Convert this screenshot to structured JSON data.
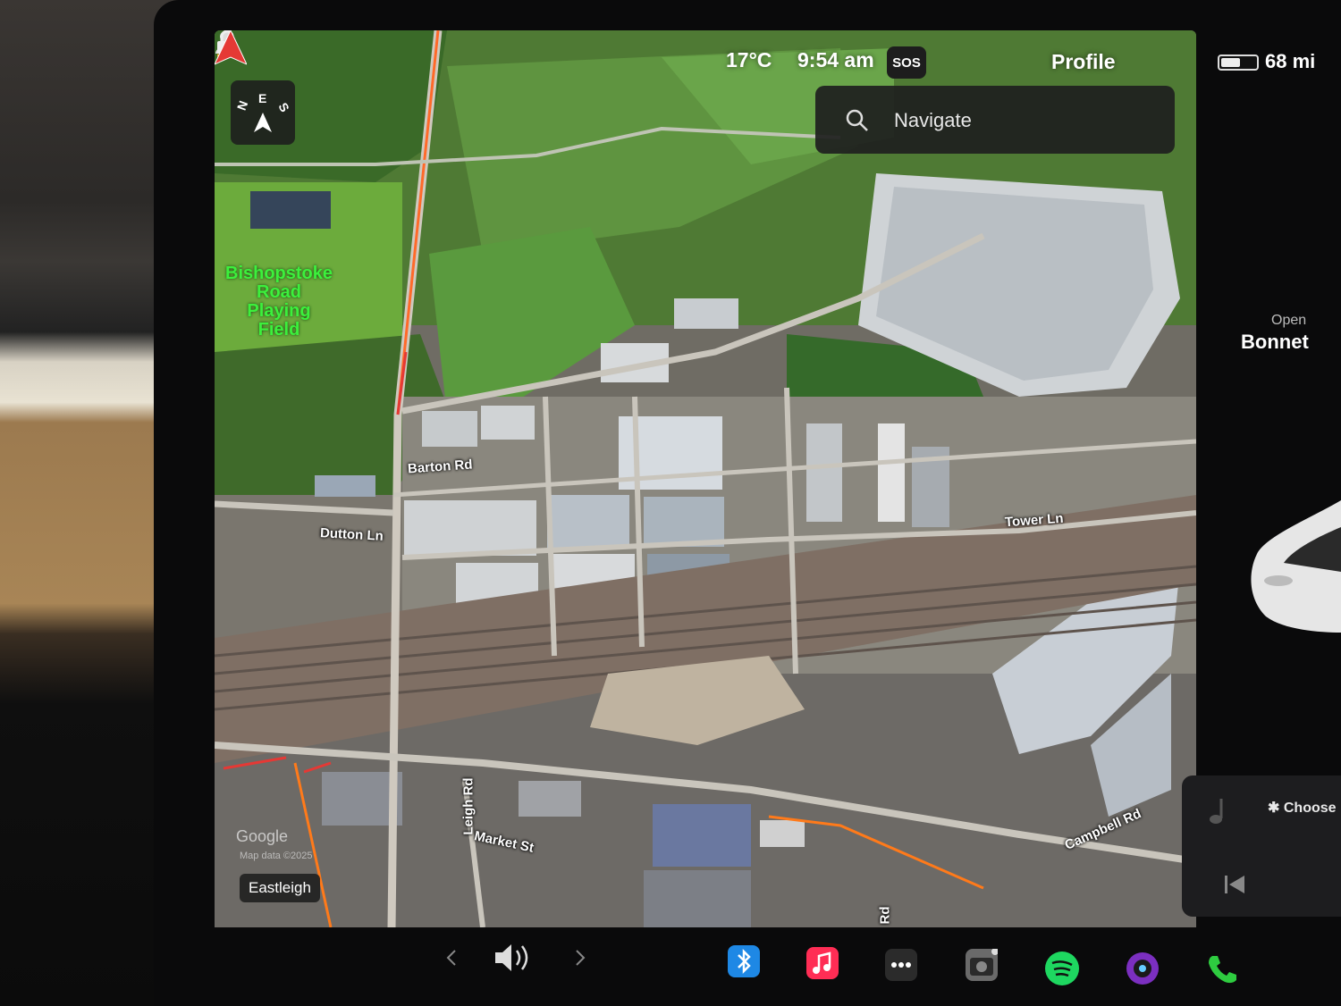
{
  "status_bar": {
    "temperature": "17°C",
    "time": "9:54 am",
    "sos_label": "SOS",
    "profile_label": "Profile",
    "range": "68 mi",
    "battery_level": 0.55
  },
  "compass": {
    "labels": [
      "N",
      "E",
      "S"
    ]
  },
  "search": {
    "placeholder": "Navigate"
  },
  "map": {
    "poi": [
      "Bishopstoke",
      "Road",
      "Playing Field"
    ],
    "streets": {
      "barton": "Barton Rd",
      "dutton": "Dutton Ln",
      "tower": "Tower Ln",
      "leigh": "Leigh Rd",
      "market": "Market St",
      "campbell": "Campbell Rd",
      "rd_bottom": "Rd"
    },
    "attribution": {
      "brand": "Google",
      "data": "Map data ©2025"
    },
    "city": "Eastleigh"
  },
  "vehicle": {
    "open_label": "Open",
    "bonnet_label": "Bonnet"
  },
  "media": {
    "bluetooth_choose": "Choose"
  },
  "dock": {
    "icons": [
      "chevron-left-icon",
      "volume-icon",
      "chevron-right-icon",
      "bluetooth-icon",
      "music-icon",
      "more-icon",
      "camera-icon",
      "spotify-icon",
      "dashcam-icon",
      "phone-icon"
    ]
  },
  "colors": {
    "accent_red": "#e53935",
    "route_orange": "#ff7a1a",
    "poi_green": "#3cf03c"
  }
}
